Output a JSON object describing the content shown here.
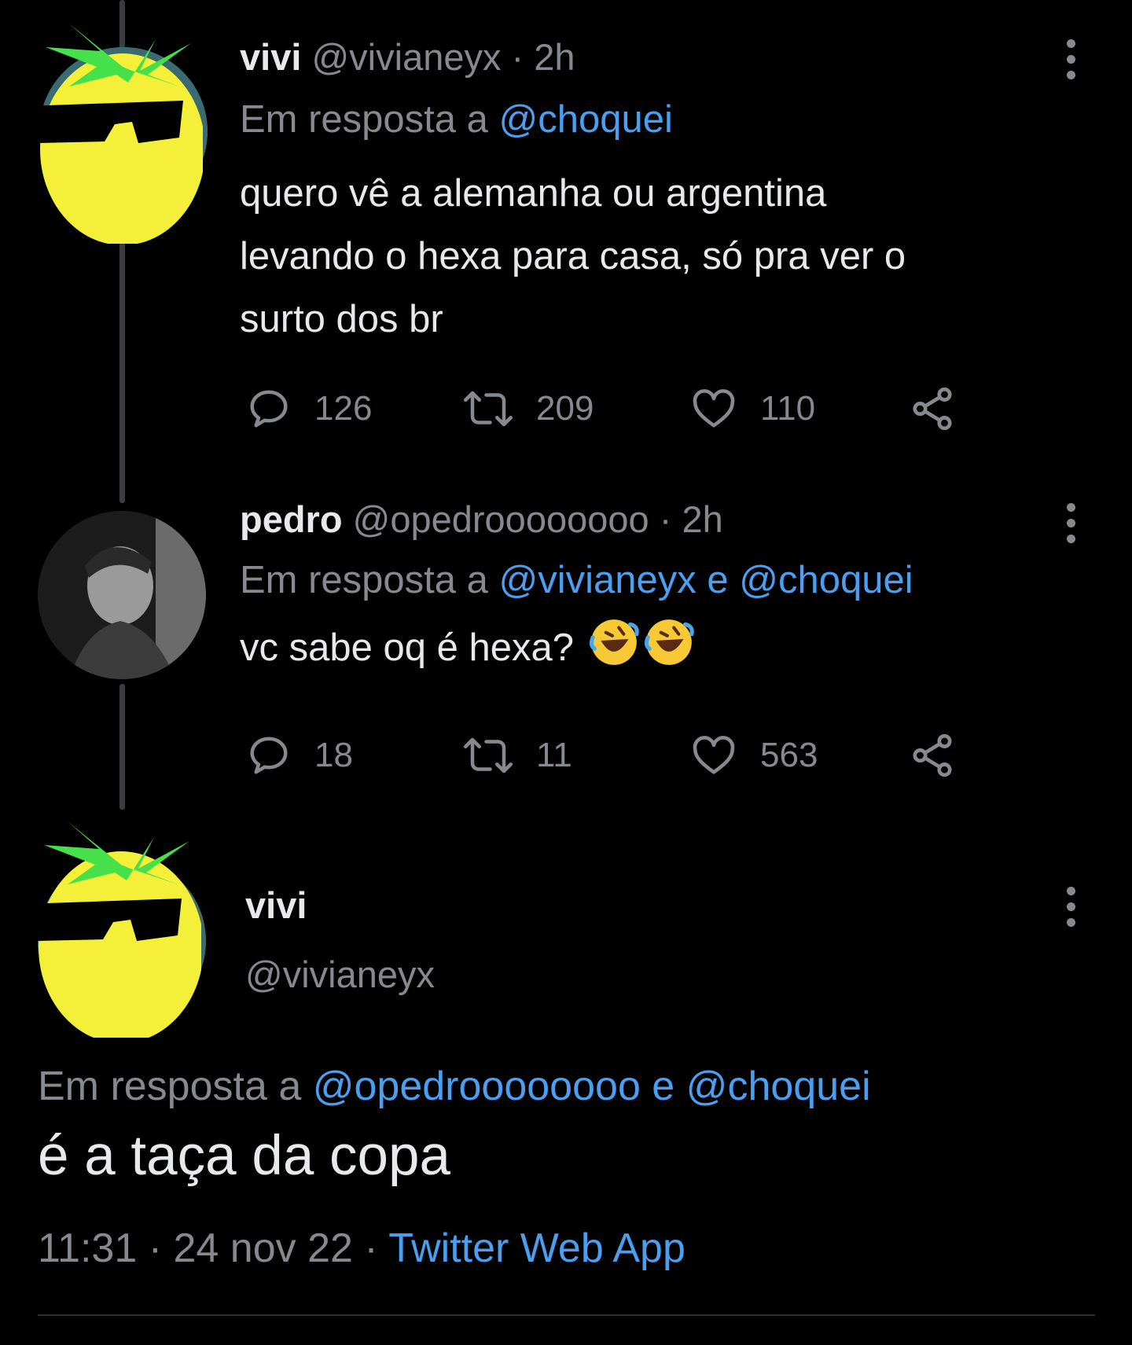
{
  "tweets": [
    {
      "name": "vivi",
      "handle": "@vivianeyx",
      "time_sep": " · ",
      "time": "2h",
      "reply_prefix": "Em resposta a ",
      "reply_handles": "@choquei",
      "text_lines": [
        "quero vê a alemanha ou argentina",
        "levando o hexa para casa, só pra ver o",
        "surto dos br"
      ],
      "replies": "126",
      "retweets": "209",
      "likes": "110",
      "avatar": "pineapple-with-sunglasses"
    },
    {
      "name": "pedro",
      "handle": "@opedroooooooo",
      "time_sep": " · ",
      "time": "2h",
      "reply_prefix": "Em resposta a ",
      "reply_handles": "@vivianeyx e @choquei",
      "text": "vc sabe oq é hexa?",
      "emoji": "rolling-on-floor-laughing",
      "replies": "18",
      "retweets": "11",
      "likes": "563",
      "avatar": "grayscale-profile-photo"
    }
  ],
  "main_tweet": {
    "name": "vivi",
    "handle": "@vivianeyx",
    "reply_prefix": "Em resposta a ",
    "reply_handles": "@opedroooooooo e @choquei",
    "text": "é a taça da copa",
    "time": "11:31",
    "sep1": " · ",
    "date": "24 nov 22",
    "sep2": " · ",
    "source": "Twitter Web App",
    "avatar": "pineapple-with-sunglasses"
  },
  "icons": {
    "reply": "reply-bubble-icon",
    "retweet": "retweet-icon",
    "like": "heart-icon",
    "share": "share-icon",
    "more": "more-vertical-icon"
  },
  "colors": {
    "background": "#000000",
    "text": "#e7e9ea",
    "muted": "#868a8f",
    "link": "#4a9ff0",
    "pineapple_body": "#f4f03a",
    "pineapple_leaves": "#45e04a"
  }
}
